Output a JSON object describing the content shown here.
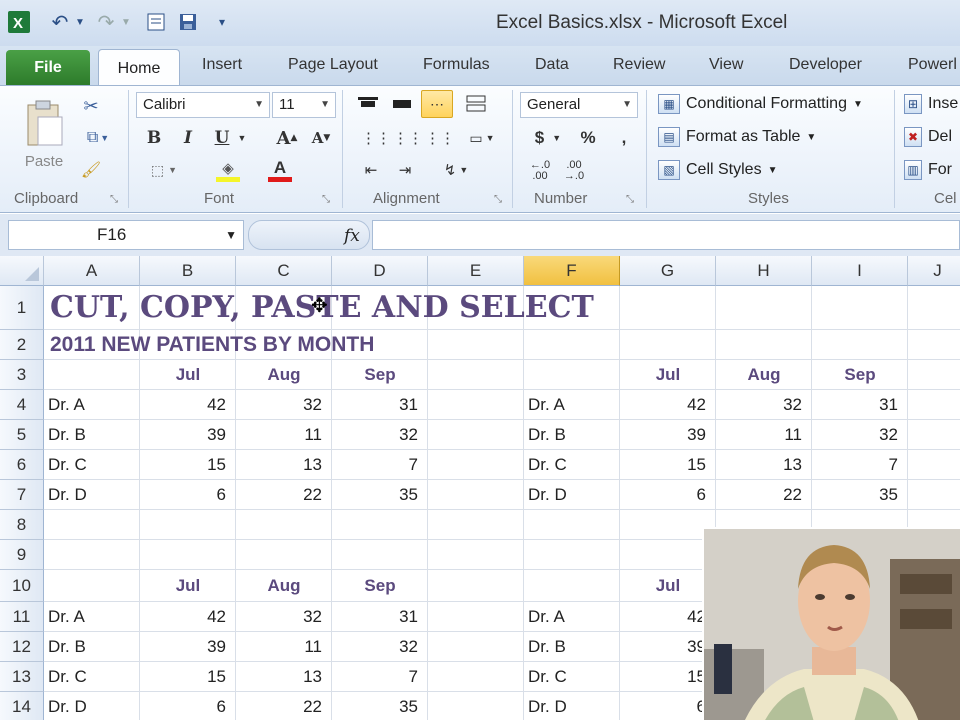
{
  "window": {
    "title": "Excel Basics.xlsx  -  Microsoft Excel"
  },
  "quick_access": {
    "icons": [
      "excel-icon",
      "undo-icon",
      "redo-icon",
      "print-preview-icon",
      "save-icon",
      "customize-icon"
    ]
  },
  "ribbon_tabs": [
    "File",
    "Home",
    "Insert",
    "Page Layout",
    "Formulas",
    "Data",
    "Review",
    "View",
    "Developer",
    "Powerl"
  ],
  "ribbon": {
    "clipboard": {
      "label": "Clipboard",
      "paste": "Paste"
    },
    "font": {
      "label": "Font",
      "name": "Calibri",
      "size": "11",
      "bold": "B",
      "italic": "I",
      "underline": "U"
    },
    "alignment": {
      "label": "Alignment"
    },
    "number": {
      "label": "Number",
      "format": "General",
      "currency": "$",
      "percent": "%",
      "comma": ",",
      "inc_decimal": "←.0 .00",
      "dec_decimal": ".00 →.0"
    },
    "styles": {
      "label": "Styles",
      "conditional": "Conditional Formatting",
      "format_table": "Format as Table",
      "cell_styles": "Cell Styles"
    },
    "cells": {
      "label": "Cel",
      "insert": "Inse",
      "delete": "Del",
      "format": "For"
    }
  },
  "formula_bar": {
    "name_box": "F16",
    "fx": "fx",
    "value": ""
  },
  "columns": [
    "A",
    "B",
    "C",
    "D",
    "E",
    "F",
    "G",
    "H",
    "I",
    "J"
  ],
  "selected_column": "F",
  "rows": [
    "1",
    "2",
    "3",
    "4",
    "5",
    "6",
    "7",
    "8",
    "9",
    "10",
    "11",
    "12",
    "13",
    "14"
  ],
  "sheet": {
    "title": "CUT, COPY, PASTE AND SELECT",
    "subtitle": "2011 NEW PATIENTS BY MONTH",
    "months": [
      "Jul",
      "Aug",
      "Sep"
    ],
    "table1": [
      {
        "name": "Dr. A",
        "values": [
          "42",
          "32",
          "31"
        ]
      },
      {
        "name": "Dr. B",
        "values": [
          "39",
          "11",
          "32"
        ]
      },
      {
        "name": "Dr. C",
        "values": [
          "15",
          "13",
          "7"
        ]
      },
      {
        "name": "Dr. D",
        "values": [
          "6",
          "22",
          "35"
        ]
      }
    ],
    "table2": [
      {
        "name": "Dr. A",
        "values": [
          "42",
          "32",
          "31"
        ]
      },
      {
        "name": "Dr. B",
        "values": [
          "39",
          "11",
          "32"
        ]
      },
      {
        "name": "Dr. C",
        "values": [
          "15",
          "13",
          "7"
        ]
      },
      {
        "name": "Dr. D",
        "values": [
          "6",
          "22",
          "35"
        ]
      }
    ],
    "table3": [
      {
        "name": "Dr. A",
        "values": [
          "42",
          "32",
          "31"
        ]
      },
      {
        "name": "Dr. B",
        "values": [
          "39",
          "11",
          "32"
        ]
      },
      {
        "name": "Dr. C",
        "values": [
          "15",
          "13",
          "7"
        ]
      },
      {
        "name": "Dr. D",
        "values": [
          "6",
          "22",
          "35"
        ]
      }
    ],
    "table4": [
      {
        "name": "Dr. A",
        "value": "42"
      },
      {
        "name": "Dr. B",
        "value": "39"
      },
      {
        "name": "Dr. C",
        "value": "15"
      },
      {
        "name": "Dr. D",
        "value": "6"
      }
    ],
    "table4_month": "Jul"
  },
  "colors": {
    "heading_purple": "#5b4a7e",
    "file_tab_green": "#2c7a2a",
    "selected_header": "#f1c040"
  }
}
